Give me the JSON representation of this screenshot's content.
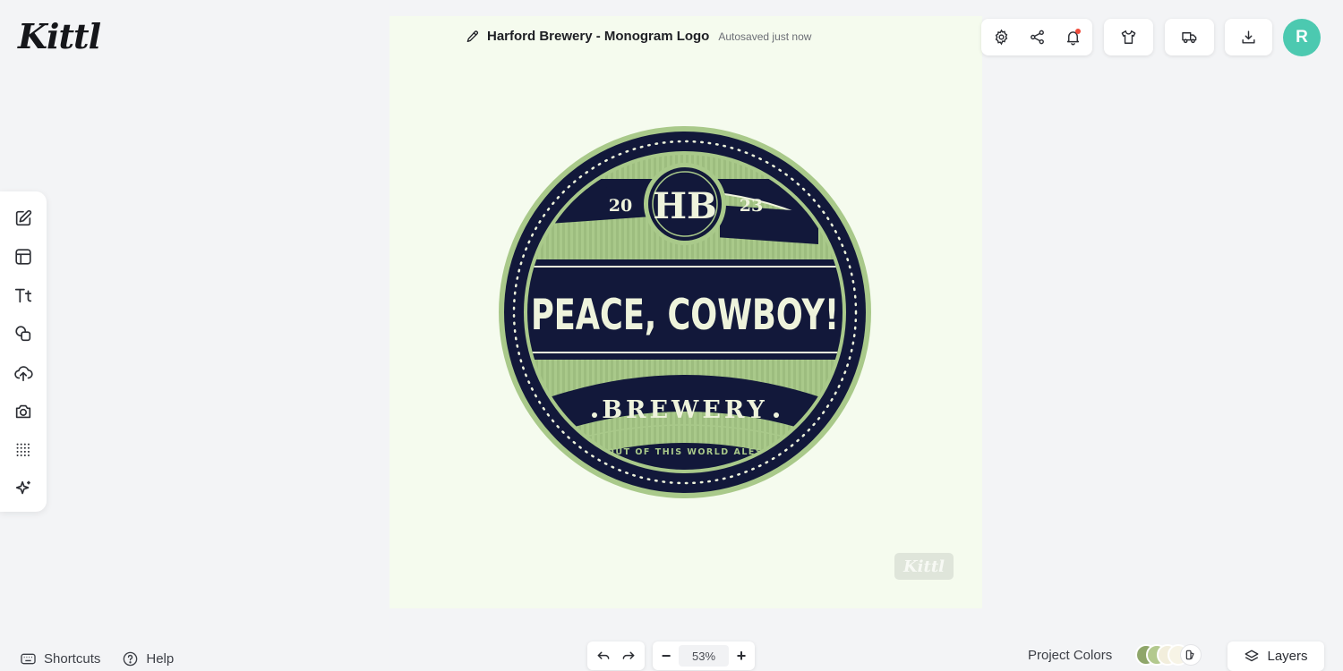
{
  "app": {
    "logo_text": "Kittl"
  },
  "document": {
    "title": "Harford Brewery - Monogram Logo",
    "save_status": "Autosaved just now"
  },
  "left_toolbar": {
    "items": [
      {
        "icon": "edit-icon"
      },
      {
        "icon": "templates-icon"
      },
      {
        "icon": "text-icon",
        "label": "Tt"
      },
      {
        "icon": "shapes-icon"
      },
      {
        "icon": "upload-icon"
      },
      {
        "icon": "camera-icon"
      },
      {
        "icon": "pattern-grid-icon"
      },
      {
        "icon": "ai-sparkle-icon"
      }
    ]
  },
  "top_right": {
    "icons": [
      "settings-icon",
      "share-icon",
      "notifications-icon",
      "tshirt-icon",
      "delivery-truck-icon",
      "download-icon"
    ],
    "avatar_initial": "R"
  },
  "design": {
    "year_left": "20",
    "year_right": "23",
    "monogram": "HB",
    "headline": "PEACE, COWBOY!",
    "subhead": "BREWERY",
    "tagline": "OUT OF THIS WORLD ALES",
    "colors": {
      "navy": "#12183a",
      "green": "#a9c98a",
      "cream": "#eef3dc",
      "olive": "#8fae6b"
    }
  },
  "watermark": "Kittl",
  "bottom": {
    "shortcuts_label": "Shortcuts",
    "help_label": "Help",
    "zoom_level": "53%",
    "project_colors_label": "Project Colors",
    "project_colors": [
      "#8fa66a",
      "#b3c98e",
      "#f2eedc",
      "#f7f4e6"
    ],
    "layers_label": "Layers"
  }
}
